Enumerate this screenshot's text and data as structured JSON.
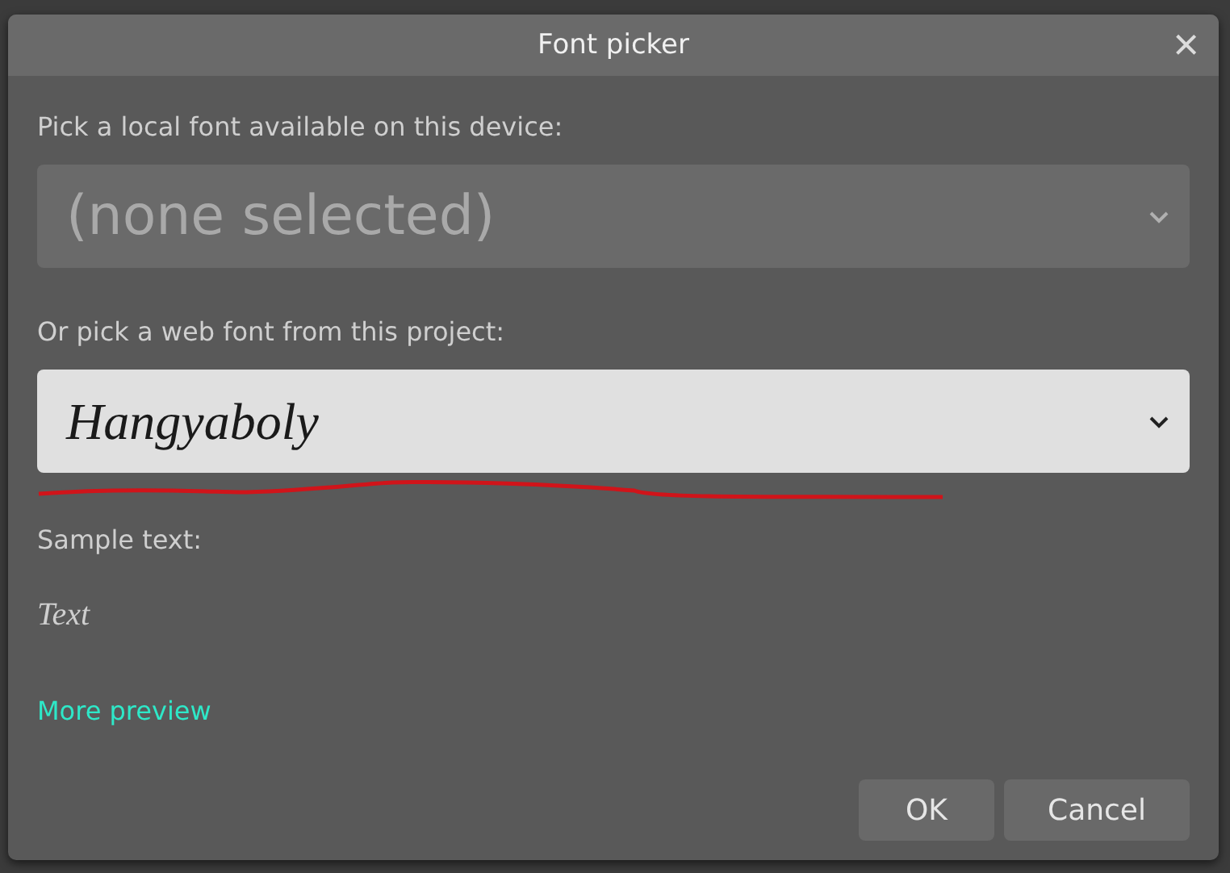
{
  "dialog": {
    "title": "Font picker",
    "close": "×"
  },
  "local_font": {
    "label": "Pick a local font available on this device:",
    "value": "(none selected)",
    "disabled": true
  },
  "web_font": {
    "label": "Or pick a web font from this project:",
    "value": "Hangyaboly",
    "disabled": false
  },
  "sample": {
    "label": "Sample text:",
    "text": "Text"
  },
  "more_preview": "More preview",
  "buttons": [
    "OK",
    "Cancel"
  ]
}
